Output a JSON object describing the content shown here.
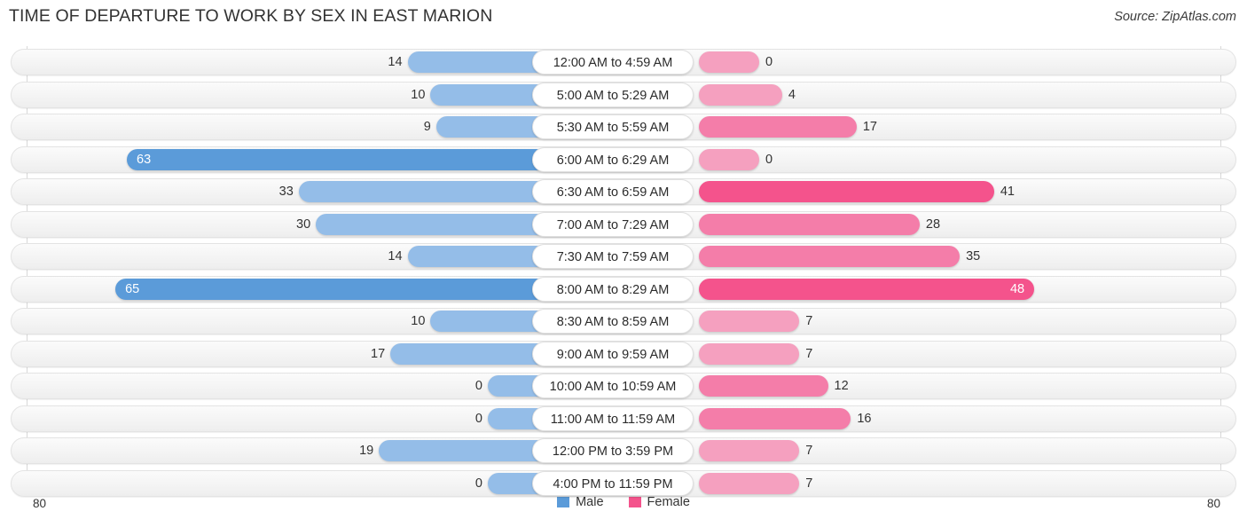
{
  "header": {
    "title": "TIME OF DEPARTURE TO WORK BY SEX IN EAST MARION",
    "source": "Source: ZipAtlas.com"
  },
  "legend": {
    "male_label": "Male",
    "female_label": "Female",
    "male_color": "#5b9bd9",
    "female_color": "#f4538c"
  },
  "axis": {
    "left_label": "80",
    "right_label": "80",
    "max": 80
  },
  "chart_data": {
    "type": "bar",
    "orientation": "horizontal-diverging",
    "title": "TIME OF DEPARTURE TO WORK BY SEX IN EAST MARION",
    "subtitle": "Source: ZipAtlas.com",
    "xlabel": "",
    "ylabel": "",
    "xlim": [
      80,
      80
    ],
    "grid": true,
    "legend_position": "bottom-center",
    "categories": [
      "12:00 AM to 4:59 AM",
      "5:00 AM to 5:29 AM",
      "5:30 AM to 5:59 AM",
      "6:00 AM to 6:29 AM",
      "6:30 AM to 6:59 AM",
      "7:00 AM to 7:29 AM",
      "7:30 AM to 7:59 AM",
      "8:00 AM to 8:29 AM",
      "8:30 AM to 8:59 AM",
      "9:00 AM to 9:59 AM",
      "10:00 AM to 10:59 AM",
      "11:00 AM to 11:59 AM",
      "12:00 PM to 3:59 PM",
      "4:00 PM to 11:59 PM"
    ],
    "series": [
      {
        "name": "Male",
        "color": "#5b9bd9",
        "values": [
          14,
          10,
          9,
          63,
          33,
          30,
          14,
          65,
          10,
          17,
          0,
          0,
          19,
          0
        ]
      },
      {
        "name": "Female",
        "color": "#f4538c",
        "values": [
          0,
          4,
          17,
          0,
          41,
          28,
          35,
          48,
          7,
          7,
          12,
          16,
          7,
          7
        ]
      }
    ]
  },
  "rows": [
    {
      "category": "12:00 AM to 4:59 AM",
      "male": "14",
      "female": "0",
      "male_tone": "low",
      "female_tone": "low",
      "male_inside": false,
      "female_inside": false
    },
    {
      "category": "5:00 AM to 5:29 AM",
      "male": "10",
      "female": "4",
      "male_tone": "low",
      "female_tone": "low",
      "male_inside": false,
      "female_inside": false
    },
    {
      "category": "5:30 AM to 5:59 AM",
      "male": "9",
      "female": "17",
      "male_tone": "low",
      "female_tone": "mid",
      "male_inside": false,
      "female_inside": false
    },
    {
      "category": "6:00 AM to 6:29 AM",
      "male": "63",
      "female": "0",
      "male_tone": "hi",
      "female_tone": "low",
      "male_inside": true,
      "female_inside": false
    },
    {
      "category": "6:30 AM to 6:59 AM",
      "male": "33",
      "female": "41",
      "male_tone": "low",
      "female_tone": "hi",
      "male_inside": false,
      "female_inside": false
    },
    {
      "category": "7:00 AM to 7:29 AM",
      "male": "30",
      "female": "28",
      "male_tone": "low",
      "female_tone": "mid",
      "male_inside": false,
      "female_inside": false
    },
    {
      "category": "7:30 AM to 7:59 AM",
      "male": "14",
      "female": "35",
      "male_tone": "low",
      "female_tone": "mid",
      "male_inside": false,
      "female_inside": false
    },
    {
      "category": "8:00 AM to 8:29 AM",
      "male": "65",
      "female": "48",
      "male_tone": "hi",
      "female_tone": "hi",
      "male_inside": true,
      "female_inside": true
    },
    {
      "category": "8:30 AM to 8:59 AM",
      "male": "10",
      "female": "7",
      "male_tone": "low",
      "female_tone": "low",
      "male_inside": false,
      "female_inside": false
    },
    {
      "category": "9:00 AM to 9:59 AM",
      "male": "17",
      "female": "7",
      "male_tone": "low",
      "female_tone": "low",
      "male_inside": false,
      "female_inside": false
    },
    {
      "category": "10:00 AM to 10:59 AM",
      "male": "0",
      "female": "12",
      "male_tone": "low",
      "female_tone": "mid",
      "male_inside": false,
      "female_inside": false
    },
    {
      "category": "11:00 AM to 11:59 AM",
      "male": "0",
      "female": "16",
      "male_tone": "low",
      "female_tone": "mid",
      "male_inside": false,
      "female_inside": false
    },
    {
      "category": "12:00 PM to 3:59 PM",
      "male": "19",
      "female": "7",
      "male_tone": "low",
      "female_tone": "low",
      "male_inside": false,
      "female_inside": false
    },
    {
      "category": "4:00 PM to 11:59 PM",
      "male": "0",
      "female": "7",
      "male_tone": "low",
      "female_tone": "low",
      "male_inside": false,
      "female_inside": false
    }
  ]
}
